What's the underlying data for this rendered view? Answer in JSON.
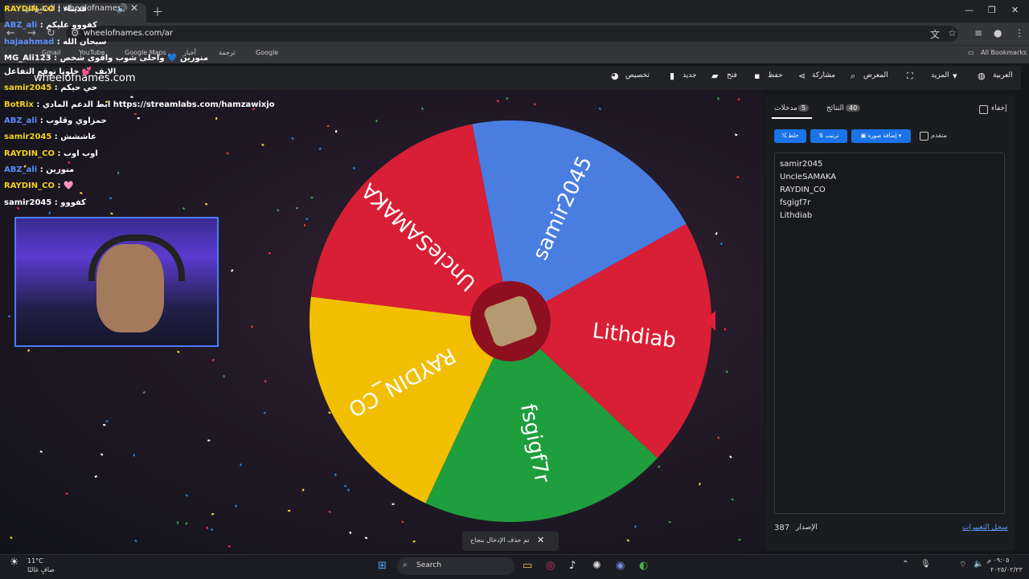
{
  "browser": {
    "tab_title": "العشوائي | wheelofnames",
    "url": "wheelofnames.com/ar",
    "bookmarks": [
      "Gmail",
      "YouTube",
      "Google Maps",
      "Google",
      "أخبار",
      "ترجمة"
    ],
    "all_bookmarks": "All Bookmarks"
  },
  "site": {
    "logo": "wheelofnames.com",
    "nav": [
      "تخصيص",
      "جديد",
      "فتح",
      "حفظ",
      "مشاركة",
      "المعرض",
      "المزيد",
      "العربية"
    ]
  },
  "panel": {
    "tab_entries": "مدخلات",
    "entries_count": "5",
    "tab_results": "النتائج",
    "results_count": "40",
    "hide": "إخفاء",
    "shuffle": "خلط",
    "sort": "ترتيب",
    "add_image": "إضافة صورة",
    "advanced": "متقدم",
    "entries": [
      "samir2045",
      "UncleSAMAKA",
      "RAYDIN_CO",
      "fsgigf7r",
      "Lithdiab"
    ],
    "version_label": "الإصدار",
    "version": "387",
    "changelog": "سجل التغييرات"
  },
  "wheel": {
    "slices": [
      {
        "label": "samir2045",
        "color": "#4a7de0"
      },
      {
        "label": "Lithdiab",
        "color": "#d81f35"
      },
      {
        "label": "fsgigf7r",
        "color": "#1f9e3d"
      },
      {
        "label": "RAYDIN_CO",
        "color": "#f2be00"
      },
      {
        "label": "UncleSAMAKA",
        "color": "#d81f35"
      }
    ],
    "pointer_color": "#e0203a"
  },
  "chat": [
    {
      "user": "RAYDIN_CO",
      "msg": "قديناء",
      "color": "yellow"
    },
    {
      "user": "ABZ_ali",
      "msg": "كفووو عليكم",
      "color": "blue"
    },
    {
      "user": "hajaahmad",
      "msg": "سبحان الله",
      "color": "blue"
    },
    {
      "user": "MG_Ali123",
      "msg": "منورين 💙 واحلى شوب واقوى شخص",
      "color": "white"
    },
    {
      "user": "",
      "msg": "الايف 💕 خلونا نوقع التفاعل",
      "color": "white"
    },
    {
      "user": "samir2045",
      "msg": "حي حيكم",
      "color": "yellow"
    },
    {
      "user": "BotRix",
      "msg": "ابط الدعم المادي https://streamlabs.com/hamzawixjo",
      "color": "yellow"
    },
    {
      "user": "ABZ_ali",
      "msg": "حمزاوي وقلوب",
      "color": "blue"
    },
    {
      "user": "samir2045",
      "msg": "عاششش",
      "color": "yellow"
    },
    {
      "user": "RAYDIN_CO",
      "msg": "اوب اوب",
      "color": "yellow"
    },
    {
      "user": "ABZ_ali",
      "msg": "منورين",
      "color": "blue"
    },
    {
      "user": "RAYDIN_CO",
      "msg": "🩷",
      "color": "yellow"
    },
    {
      "user": "samir2045",
      "msg": "كفووو",
      "color": "white"
    }
  ],
  "toast": {
    "text": "تم حذف الإدخال بنجاح"
  },
  "taskbar": {
    "temperature": "11°C",
    "weather": "صافٍ غالبًا",
    "search": "Search",
    "time": "٠٩:٠٥ م",
    "date": "٢٠٢٥/٠٢/٢٣"
  }
}
